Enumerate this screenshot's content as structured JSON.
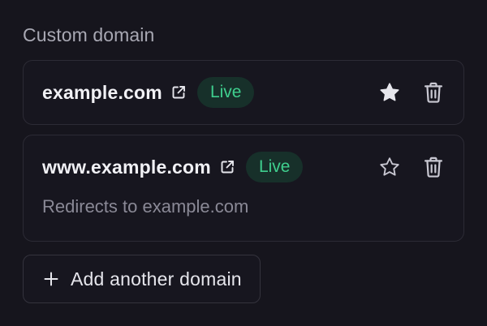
{
  "section": {
    "title": "Custom domain"
  },
  "domains": [
    {
      "name": "example.com",
      "status": "Live",
      "primary": true,
      "icons": {
        "link": "external-link-icon",
        "star": "star-filled-icon",
        "delete": "trash-icon"
      }
    },
    {
      "name": "www.example.com",
      "status": "Live",
      "primary": false,
      "note": "Redirects to example.com",
      "icons": {
        "link": "external-link-icon",
        "star": "star-outline-icon",
        "delete": "trash-icon"
      }
    }
  ],
  "add_button": {
    "label": "Add another domain",
    "icon": "plus-icon"
  },
  "colors": {
    "background": "#16151d",
    "card_border": "#2c2b35",
    "live_text": "#3fcf8e",
    "live_bg": "#17302a",
    "muted_text": "#8a8996"
  }
}
